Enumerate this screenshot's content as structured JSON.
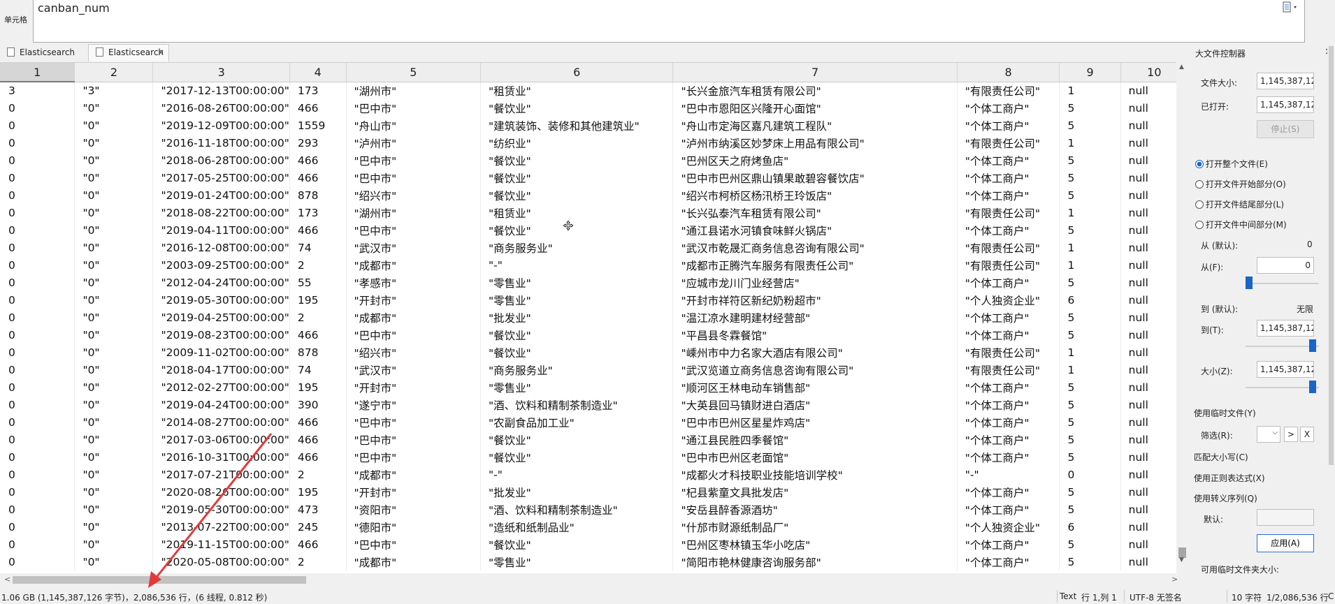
{
  "cell_editor": {
    "label": "单元格",
    "value": "canban_num"
  },
  "tabs": [
    {
      "label": "Elasticsearch"
    },
    {
      "label": "Elasticsearch",
      "close": "×"
    }
  ],
  "grid": {
    "columns": [
      "1",
      "2",
      "3",
      "4",
      "5",
      "6",
      "7",
      "8",
      "9",
      "10"
    ],
    "rows": [
      [
        "3",
        "\"3\"",
        "\"2017-12-13T00:00:00\"",
        "173",
        "\"湖州市\"",
        "\"租赁业\"",
        "\"长兴金旅汽车租赁有限公司\"",
        "\"有限责任公司\"",
        "1",
        "null"
      ],
      [
        "0",
        "\"0\"",
        "\"2016-08-26T00:00:00\"",
        "466",
        "\"巴中市\"",
        "\"餐饮业\"",
        "\"巴中市恩阳区兴隆开心面馆\"",
        "\"个体工商户\"",
        "5",
        "null"
      ],
      [
        "0",
        "\"0\"",
        "\"2019-12-09T00:00:00\"",
        "1559",
        "\"舟山市\"",
        "\"建筑装饰、装修和其他建筑业\"",
        "\"舟山市定海区嘉凡建筑工程队\"",
        "\"个体工商户\"",
        "5",
        "null"
      ],
      [
        "0",
        "\"0\"",
        "\"2016-11-18T00:00:00\"",
        "293",
        "\"泸州市\"",
        "\"纺织业\"",
        "\"泸州市纳溪区妙梦床上用品有限公司\"",
        "\"有限责任公司\"",
        "1",
        "null"
      ],
      [
        "0",
        "\"0\"",
        "\"2018-06-28T00:00:00\"",
        "466",
        "\"巴中市\"",
        "\"餐饮业\"",
        "\"巴州区天之府烤鱼店\"",
        "\"个体工商户\"",
        "5",
        "null"
      ],
      [
        "0",
        "\"0\"",
        "\"2017-05-25T00:00:00\"",
        "466",
        "\"巴中市\"",
        "\"餐饮业\"",
        "\"巴中市巴州区鼎山镇果敢碧容餐饮店\"",
        "\"个体工商户\"",
        "5",
        "null"
      ],
      [
        "0",
        "\"0\"",
        "\"2019-01-24T00:00:00\"",
        "878",
        "\"绍兴市\"",
        "\"餐饮业\"",
        "\"绍兴市柯桥区杨汛桥王玲饭店\"",
        "\"个体工商户\"",
        "5",
        "null"
      ],
      [
        "0",
        "\"0\"",
        "\"2018-08-22T00:00:00\"",
        "173",
        "\"湖州市\"",
        "\"租赁业\"",
        "\"长兴弘泰汽车租赁有限公司\"",
        "\"有限责任公司\"",
        "1",
        "null"
      ],
      [
        "0",
        "\"0\"",
        "\"2019-04-11T00:00:00\"",
        "466",
        "\"巴中市\"",
        "\"餐饮业\"",
        "\"通江县诺水河镇食味鲜火锅店\"",
        "\"个体工商户\"",
        "5",
        "null"
      ],
      [
        "0",
        "\"0\"",
        "\"2016-12-08T00:00:00\"",
        "74",
        "\"武汉市\"",
        "\"商务服务业\"",
        "\"武汉市乾晟汇商务信息咨询有限公司\"",
        "\"有限责任公司\"",
        "1",
        "null"
      ],
      [
        "0",
        "\"0\"",
        "\"2003-09-25T00:00:00\"",
        "2",
        "\"成都市\"",
        "\"-\"",
        "\"成都市正腾汽车服务有限责任公司\"",
        "\"有限责任公司\"",
        "1",
        "null"
      ],
      [
        "0",
        "\"0\"",
        "\"2012-04-24T00:00:00\"",
        "55",
        "\"孝感市\"",
        "\"零售业\"",
        "\"应城市龙川门业经营店\"",
        "\"个体工商户\"",
        "5",
        "null"
      ],
      [
        "0",
        "\"0\"",
        "\"2019-05-30T00:00:00\"",
        "195",
        "\"开封市\"",
        "\"零售业\"",
        "\"开封市祥符区新纪奶粉超市\"",
        "\"个人独资企业\"",
        "6",
        "null"
      ],
      [
        "0",
        "\"0\"",
        "\"2019-04-25T00:00:00\"",
        "2",
        "\"成都市\"",
        "\"批发业\"",
        "\"温江凉水建明建材经营部\"",
        "\"个体工商户\"",
        "5",
        "null"
      ],
      [
        "0",
        "\"0\"",
        "\"2019-08-23T00:00:00\"",
        "466",
        "\"巴中市\"",
        "\"餐饮业\"",
        "\"平昌县冬霖餐馆\"",
        "\"个体工商户\"",
        "5",
        "null"
      ],
      [
        "0",
        "\"0\"",
        "\"2009-11-02T00:00:00\"",
        "878",
        "\"绍兴市\"",
        "\"餐饮业\"",
        "\"嵊州市中力名家大酒店有限公司\"",
        "\"有限责任公司\"",
        "1",
        "null"
      ],
      [
        "0",
        "\"0\"",
        "\"2018-04-17T00:00:00\"",
        "74",
        "\"武汉市\"",
        "\"商务服务业\"",
        "\"武汉览道立商务信息咨询有限公司\"",
        "\"有限责任公司\"",
        "1",
        "null"
      ],
      [
        "0",
        "\"0\"",
        "\"2012-02-27T00:00:00\"",
        "195",
        "\"开封市\"",
        "\"零售业\"",
        "\"顺河区王林电动车销售部\"",
        "\"个体工商户\"",
        "5",
        "null"
      ],
      [
        "0",
        "\"0\"",
        "\"2019-04-24T00:00:00\"",
        "390",
        "\"遂宁市\"",
        "\"酒、饮料和精制茶制造业\"",
        "\"大英县回马镇财进白酒店\"",
        "\"个体工商户\"",
        "5",
        "null"
      ],
      [
        "0",
        "\"0\"",
        "\"2014-08-27T00:00:00\"",
        "466",
        "\"巴中市\"",
        "\"农副食品加工业\"",
        "\"巴中市巴州区星星炸鸡店\"",
        "\"个体工商户\"",
        "5",
        "null"
      ],
      [
        "0",
        "\"0\"",
        "\"2017-03-06T00:00:00\"",
        "466",
        "\"巴中市\"",
        "\"餐饮业\"",
        "\"通江县民胜四季餐馆\"",
        "\"个体工商户\"",
        "5",
        "null"
      ],
      [
        "0",
        "\"0\"",
        "\"2016-10-31T00:00:00\"",
        "466",
        "\"巴中市\"",
        "\"餐饮业\"",
        "\"巴中市巴州区老面馆\"",
        "\"个体工商户\"",
        "5",
        "null"
      ],
      [
        "0",
        "\"0\"",
        "\"2017-07-21T00:00:00\"",
        "2",
        "\"成都市\"",
        "\"-\"",
        "\"成都火才科技职业技能培训学校\"",
        "\"-\"",
        "0",
        "null"
      ],
      [
        "0",
        "\"0\"",
        "\"2020-08-26T00:00:00\"",
        "195",
        "\"开封市\"",
        "\"批发业\"",
        "\"杞县紫童文具批发店\"",
        "\"个体工商户\"",
        "5",
        "null"
      ],
      [
        "0",
        "\"0\"",
        "\"2019-05-30T00:00:00\"",
        "473",
        "\"资阳市\"",
        "\"酒、饮料和精制茶制造业\"",
        "\"安岳县醉香源酒坊\"",
        "\"个体工商户\"",
        "5",
        "null"
      ],
      [
        "0",
        "\"0\"",
        "\"2013-07-22T00:00:00\"",
        "245",
        "\"德阳市\"",
        "\"造纸和纸制品业\"",
        "\"什邡市财源纸制品厂\"",
        "\"个人独资企业\"",
        "6",
        "null"
      ],
      [
        "0",
        "\"0\"",
        "\"2019-11-15T00:00:00\"",
        "466",
        "\"巴中市\"",
        "\"餐饮业\"",
        "\"巴州区枣林镇玉华小吃店\"",
        "\"个体工商户\"",
        "5",
        "null"
      ],
      [
        "0",
        "\"0\"",
        "\"2020-05-08T00:00:00\"",
        "2",
        "\"成都市\"",
        "\"零售业\"",
        "\"简阳市艳林健康咨询服务部\"",
        "\"个体工商户\"",
        "5",
        "null"
      ]
    ]
  },
  "statusbar": {
    "size": "1.06 GB (1,145,387,126 字节)，2,086,536 行，(6 线程, 0.812 秒)",
    "mode": "Text",
    "position": "行 1,列 1",
    "encoding": "UTF-8 无签名",
    "chars": "10 字符",
    "row_count": "1/2,086,536 行",
    "tail": "C"
  },
  "side_panel": {
    "title": "大文件控制器",
    "close": "×",
    "file_size_label": "文件大小:",
    "file_size": "1,145,387,126",
    "opened_label": "已打开:",
    "opened": "1,145,387,126",
    "stop_label": "停止(S)",
    "radio_options": [
      {
        "label": "打开整个文件(E)",
        "selected": true
      },
      {
        "label": "打开文件开始部分(O)",
        "selected": false
      },
      {
        "label": "打开文件结尾部分(L)",
        "selected": false
      },
      {
        "label": "打开文件中间部分(M)",
        "selected": false
      }
    ],
    "from_default_label": "从 (默认):",
    "from_default": "0",
    "from_label": "从(F):",
    "from_value": "0",
    "to_default_label": "到 (默认):",
    "to_default": "无限",
    "to_label": "到(T):",
    "to_value": "1,145,387,126",
    "size_label": "大小(Z):",
    "size_value": "1,145,387,126",
    "use_temp_label": "使用临时文件(Y)",
    "filter_label": "筛选(R):",
    "filter_btn": ">",
    "filter_clear": "X",
    "match_case": "匹配大小写(C)",
    "use_regex": "使用正则表达式(X)",
    "use_escape": "使用转义序列(Q)",
    "default_label": "默认:",
    "apply_label": "应用(A)",
    "temp_folder_label": "可用临时文件夹大小:"
  },
  "colors": {
    "accent": "#1a63c8",
    "arrow": "#e23a3a"
  }
}
